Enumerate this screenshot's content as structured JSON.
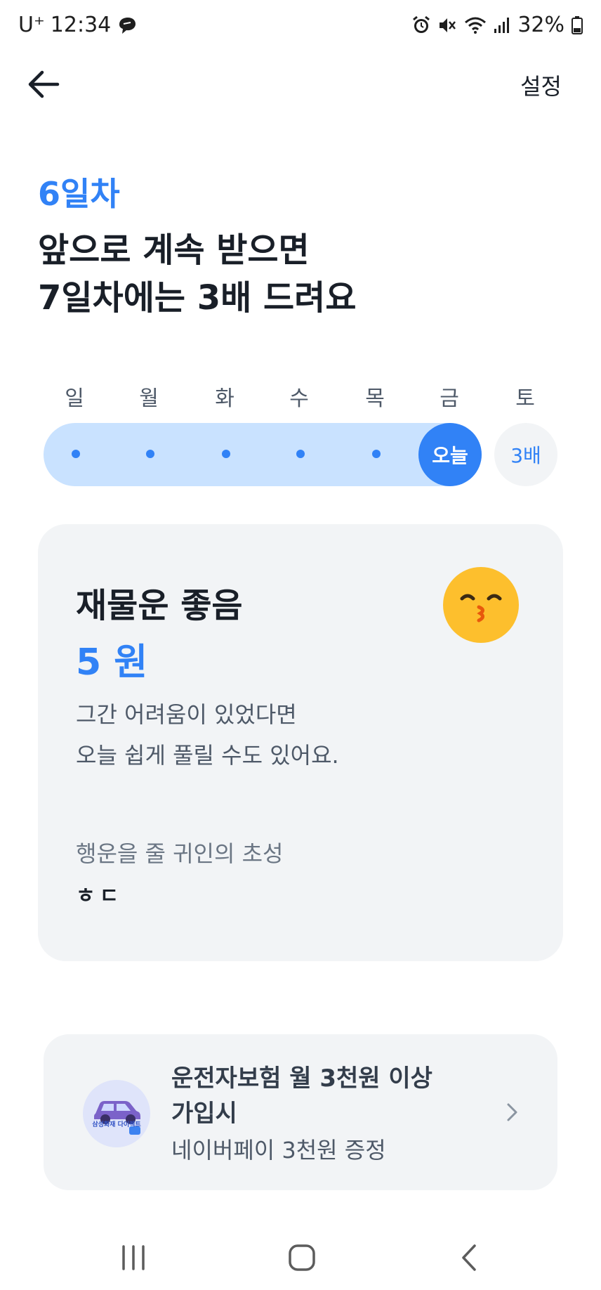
{
  "status_bar": {
    "carrier": "U⁺",
    "time": "12:34",
    "battery": "32%",
    "icons": [
      "alarm-icon",
      "mute-icon",
      "wifi-icon",
      "signal-icon",
      "battery-icon"
    ]
  },
  "nav": {
    "settings_label": "설정"
  },
  "header": {
    "day_label": "6일차",
    "headline_line1": "앞으로 계속 받으면",
    "headline_line2": "7일차에는 3배 드려요"
  },
  "week": {
    "days": [
      "일",
      "월",
      "화",
      "수",
      "목",
      "금",
      "토"
    ],
    "today_label": "오늘",
    "bonus_label": "3배",
    "completed_days": 5
  },
  "fortune": {
    "title": "재물운 좋음",
    "amount": "5 원",
    "desc_line1": "그간 어려움이 있었다면",
    "desc_line2": "오늘 쉽게 풀릴 수도 있어요.",
    "helper_label": "행운을 줄 귀인의 초성",
    "helper_value": "ㅎㄷ",
    "emoji": "kissing-face-icon"
  },
  "ad": {
    "logo_text": "삼성화재 다이렉트",
    "line1": "운전자보험 월 3천원 이상",
    "line2": "가입시",
    "line3": "네이버페이 3천원 증정"
  },
  "colors": {
    "accent": "#3182f6",
    "track": "#c9e2ff",
    "card_bg": "#f2f4f6",
    "emoji": "#fdbf2d"
  }
}
